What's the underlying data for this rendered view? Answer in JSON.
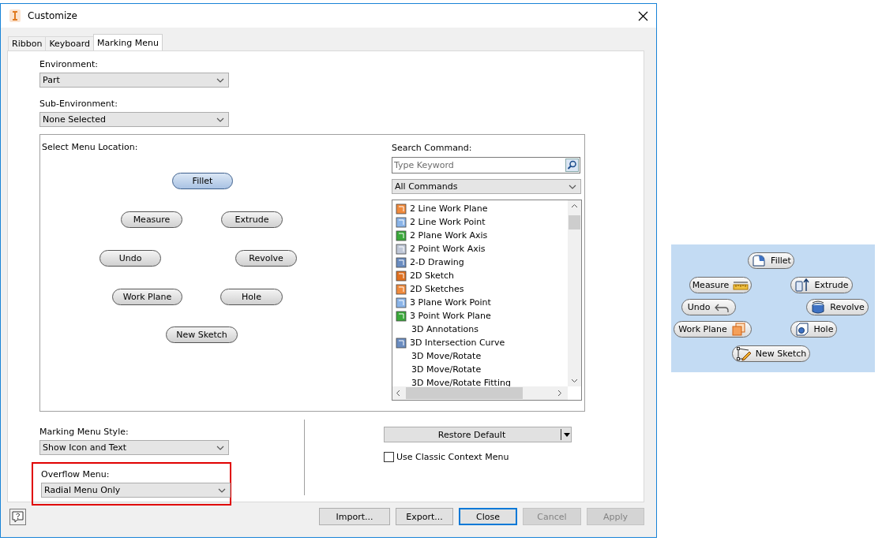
{
  "window": {
    "title": "Customize"
  },
  "tabs": [
    {
      "label": "Ribbon",
      "selected": false
    },
    {
      "label": "Keyboard",
      "selected": false
    },
    {
      "label": "Marking Menu",
      "selected": true
    }
  ],
  "environment": {
    "label": "Environment:",
    "value": "Part"
  },
  "sub_environment": {
    "label": "Sub-Environment:",
    "value": "None Selected"
  },
  "menu_location": {
    "label": "Select Menu Location:",
    "items": [
      {
        "label": "Fillet",
        "selected": true
      },
      {
        "label": "Measure",
        "selected": false
      },
      {
        "label": "Extrude",
        "selected": false
      },
      {
        "label": "Undo",
        "selected": false
      },
      {
        "label": "Revolve",
        "selected": false
      },
      {
        "label": "Work Plane",
        "selected": false
      },
      {
        "label": "Hole",
        "selected": false
      },
      {
        "label": "New Sketch",
        "selected": false
      }
    ]
  },
  "search_command": {
    "label": "Search Command:",
    "placeholder": "Type Keyword",
    "filter": "All Commands",
    "commands": [
      {
        "label": "2 Line Work Plane",
        "icon": true
      },
      {
        "label": "2 Line Work Point",
        "icon": true
      },
      {
        "label": "2 Plane Work Axis",
        "icon": true
      },
      {
        "label": "2 Point Work Axis",
        "icon": true
      },
      {
        "label": "2-D Drawing",
        "icon": true
      },
      {
        "label": "2D Sketch",
        "icon": true
      },
      {
        "label": "2D Sketches",
        "icon": true
      },
      {
        "label": "3 Plane Work Point",
        "icon": true
      },
      {
        "label": "3 Point Work Plane",
        "icon": true
      },
      {
        "label": "3D Annotations",
        "icon": false
      },
      {
        "label": "3D Intersection Curve",
        "icon": true
      },
      {
        "label": "3D Move/Rotate",
        "icon": false
      },
      {
        "label": "3D Move/Rotate",
        "icon": false
      },
      {
        "label": "3D Move/Rotate Fitting",
        "icon": false
      }
    ]
  },
  "marking_menu_style": {
    "label": "Marking Menu Style:",
    "value": "Show Icon and Text"
  },
  "overflow_menu": {
    "label": "Overflow Menu:",
    "value": "Radial Menu Only",
    "highlighted": true
  },
  "restore_default": {
    "label": "Restore Default"
  },
  "classic_context_menu": {
    "label": "Use Classic Context Menu",
    "checked": false
  },
  "buttons": [
    {
      "label": "Import...",
      "default": false,
      "disabled": false
    },
    {
      "label": "Export...",
      "default": false,
      "disabled": false
    },
    {
      "label": "Close",
      "default": true,
      "disabled": false
    },
    {
      "label": "Cancel",
      "default": false,
      "disabled": true
    },
    {
      "label": "Apply",
      "default": false,
      "disabled": true
    }
  ],
  "preview": {
    "items": [
      {
        "label": "Fillet"
      },
      {
        "label": "Measure"
      },
      {
        "label": "Extrude"
      },
      {
        "label": "Undo"
      },
      {
        "label": "Revolve"
      },
      {
        "label": "Work Plane"
      },
      {
        "label": "Hole"
      },
      {
        "label": "New Sketch"
      }
    ]
  }
}
